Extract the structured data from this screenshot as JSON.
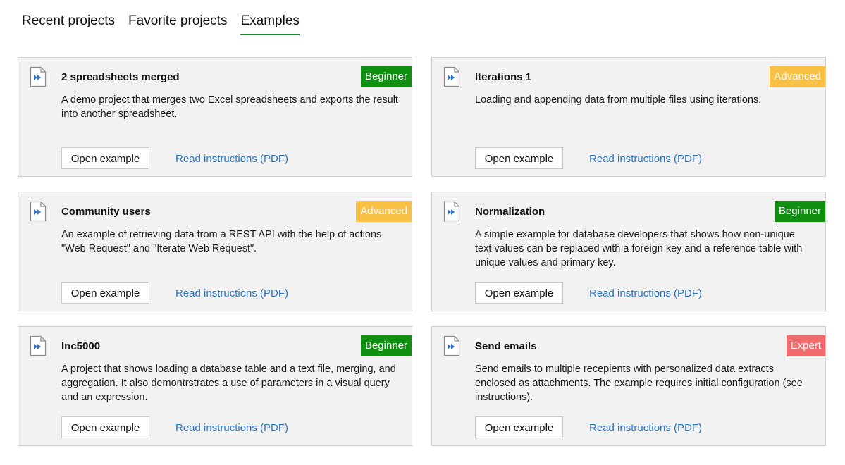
{
  "tabs": [
    {
      "label": "Recent projects",
      "active": false
    },
    {
      "label": "Favorite projects",
      "active": false
    },
    {
      "label": "Examples",
      "active": true
    }
  ],
  "colors": {
    "accent": "#1e8a2e",
    "beginner": "#109010",
    "advanced": "#f8c044",
    "expert": "#f06c6c",
    "link": "#2a74c8"
  },
  "cards": [
    {
      "title": "2 spreadsheets merged",
      "level": "Beginner",
      "description": "A demo project that merges two Excel spreadsheets and exports the result into another spreadsheet.",
      "open_label": "Open example",
      "instructions_label": "Read instructions (PDF)",
      "icon": "project-file-icon"
    },
    {
      "title": "Iterations 1",
      "level": "Advanced",
      "description": "Loading and appending data from multiple files using iterations.",
      "open_label": "Open example",
      "instructions_label": "Read instructions (PDF)",
      "icon": "project-file-icon"
    },
    {
      "title": "Community users",
      "level": "Advanced",
      "description": "An example of retrieving data from a REST API with the help of actions \"Web Request\" and \"Iterate Web Request\".",
      "open_label": "Open example",
      "instructions_label": "Read instructions (PDF)",
      "icon": "project-file-icon"
    },
    {
      "title": "Normalization",
      "level": "Beginner",
      "description": "A simple example for database developers that shows how non-unique text values can be replaced with a foreign key and a reference table with unique values and primary key.",
      "open_label": "Open example",
      "instructions_label": "Read instructions (PDF)",
      "icon": "project-file-icon"
    },
    {
      "title": "Inc5000",
      "level": "Beginner",
      "description": "A project that shows loading a database table and a text file, merging, and aggregation. It also demontrstrates a use of parameters in a visual query and an expression.",
      "open_label": "Open example",
      "instructions_label": "Read instructions (PDF)",
      "icon": "project-file-icon"
    },
    {
      "title": "Send emails",
      "level": "Expert",
      "description": "Send emails to multiple recepients with personalized data extracts enclosed as attachments. The example requires initial configuration (see instructions).",
      "open_label": "Open example",
      "instructions_label": "Read instructions (PDF)",
      "icon": "project-file-icon"
    }
  ]
}
